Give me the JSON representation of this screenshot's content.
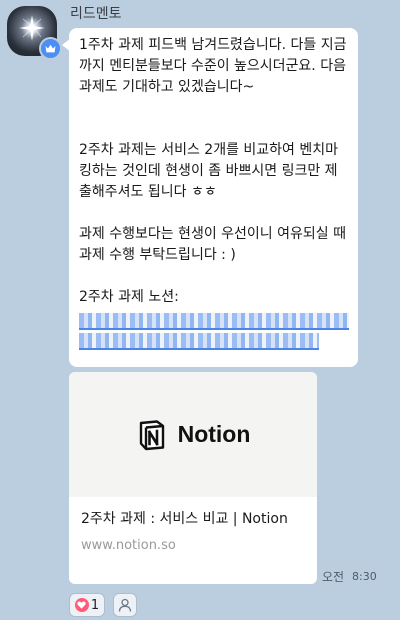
{
  "sender": {
    "name": "리드멘토",
    "avatar_icon": "sparkle-avatar",
    "badge_icon": "crown-icon"
  },
  "message": {
    "paragraphs": [
      "1주차 과제 피드백 남겨드렸습니다. 다들 지금까지 멘티분들보다 수준이 높으시더군요. 다음 과제도 기대하고 있겠습니다~",
      "2주차 과제는 서비스 2개를 비교하여 벤치마킹하는 것인데 현생이 좀 바쁘시면 링크만 제출해주셔도 됩니다 ㅎㅎ",
      "과제 수행보다는 현생이 우선이니 여유되실 때 과제 수행 부탁드립니다 : )",
      "2주차 과제 노션:"
    ],
    "link_state": "redacted"
  },
  "link_preview": {
    "brand": "Notion",
    "title": "2주차 과제 : 서비스 비교 | Notion",
    "domain": "www.notion.so"
  },
  "meta": {
    "period": "오전",
    "time": "8:30"
  },
  "reactions": {
    "heart_count": "1",
    "heart_color": "#ff5a7a",
    "add_icon": "person-icon"
  },
  "colors": {
    "background": "#bacee0",
    "bubble": "#ffffff",
    "badge": "#4c8ef3",
    "link": "#4a86ea"
  }
}
